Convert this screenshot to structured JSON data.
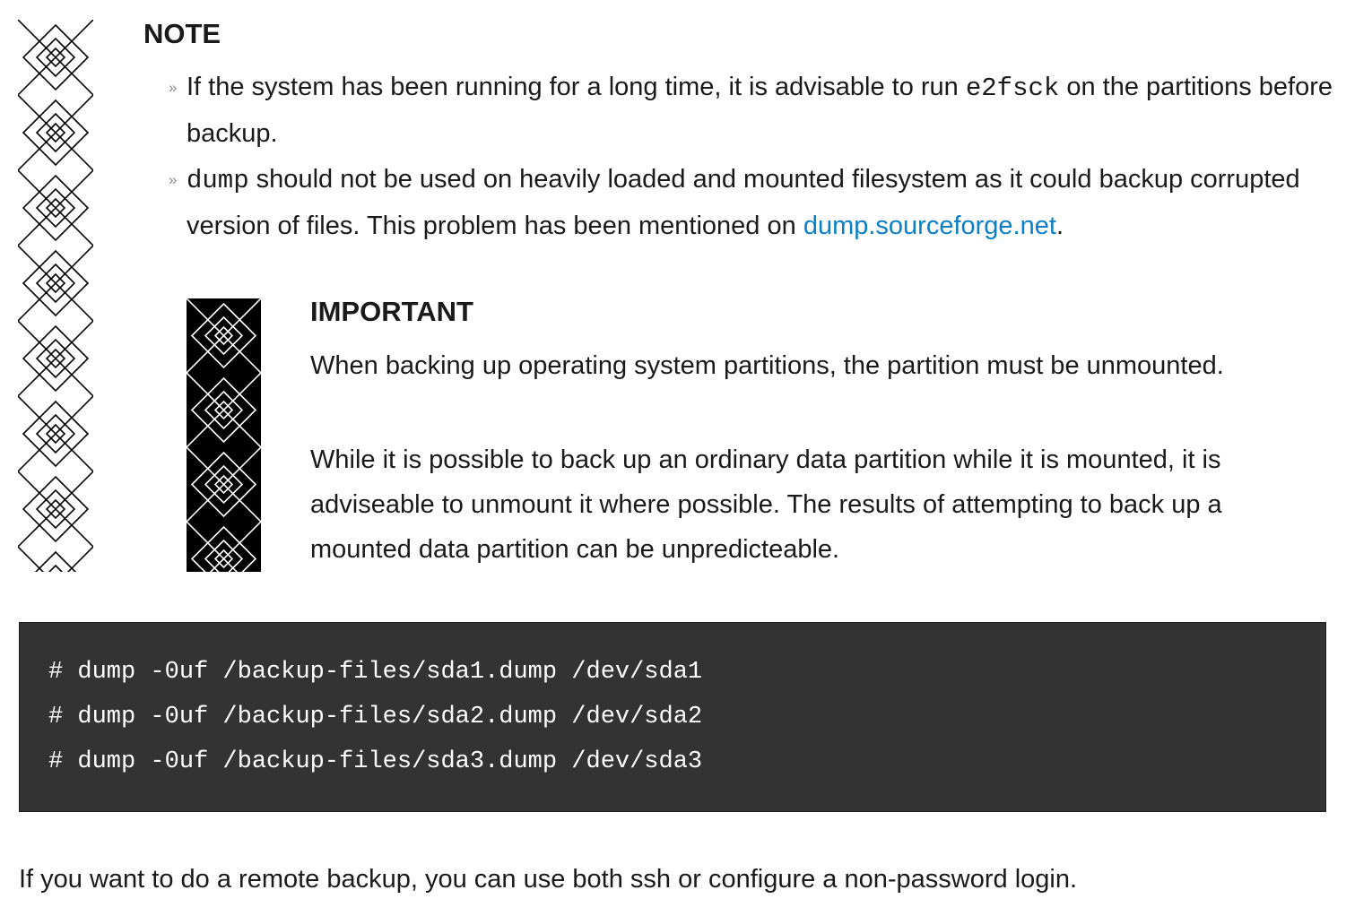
{
  "note": {
    "icon": "note-diamond-pattern-icon",
    "title": "NOTE",
    "item1": {
      "text_before": "If the system has been running for a long time, it is advisable to run ",
      "code": "e2fsck",
      "text_after": " on the partitions before backup."
    },
    "item2": {
      "code": "dump",
      "text_before": " should not be used on heavily loaded and mounted filesystem as it could backup corrupted version of files. This problem has been mentioned on ",
      "link": "dump.sourceforge.net",
      "text_after": "."
    }
  },
  "important": {
    "icon": "important-diamond-pattern-icon",
    "title": "IMPORTANT",
    "paragraph1": "When backing up operating system partitions, the partition must be unmounted.",
    "paragraph2": "While it is possible to back up an ordinary data partition while it is mounted, it is adviseable to unmount it where possible. The results of attempting to back up a mounted data partition can be unpredicteable."
  },
  "code_block": {
    "lines": [
      "# dump -0uf /backup-files/sda1.dump /dev/sda1",
      "# dump -0uf /backup-files/sda2.dump /dev/sda2",
      "# dump -0uf /backup-files/sda3.dump /dev/sda3"
    ]
  },
  "footer": {
    "text": "If you want to do a remote backup, you can use both ssh or configure a non-password login."
  },
  "colors": {
    "link": "#0b7fc7",
    "code_background": "#333333",
    "code_text": "#ffffff",
    "text": "#1a1a1a",
    "important_icon_background": "#000000"
  }
}
